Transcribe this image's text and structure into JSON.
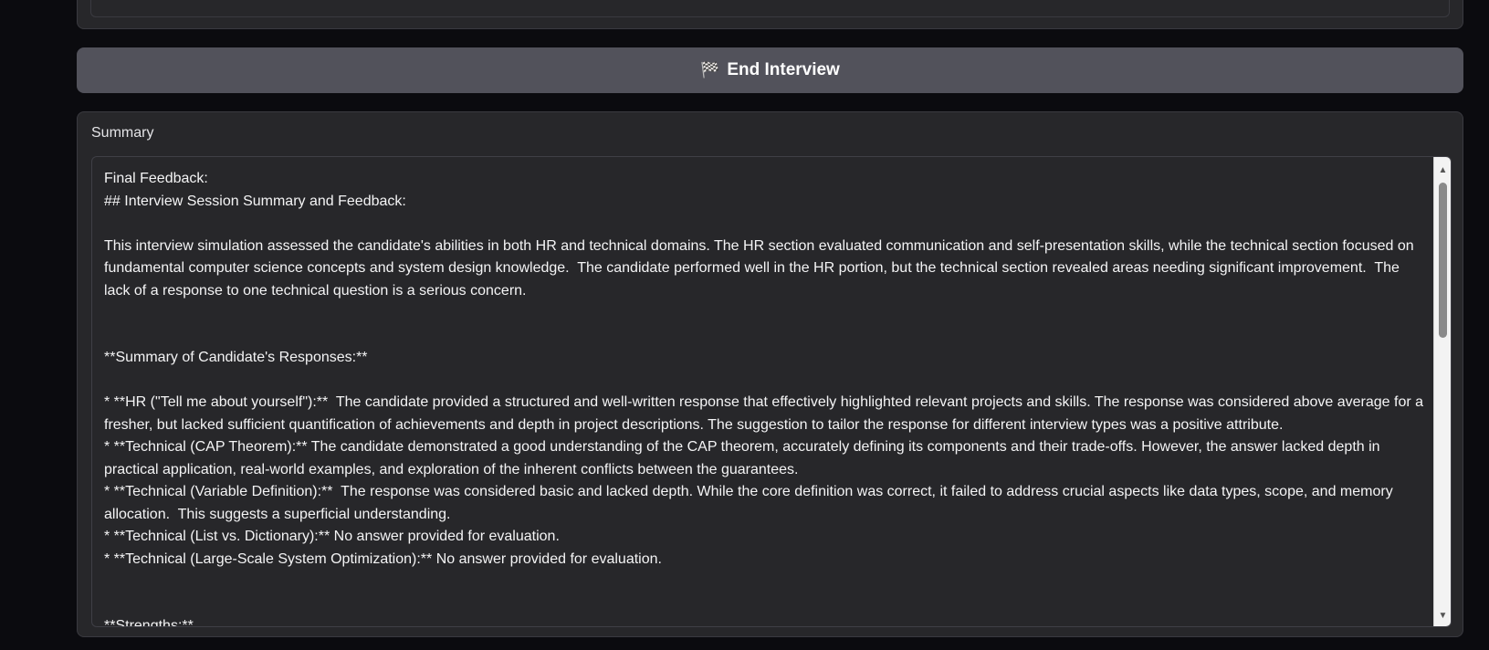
{
  "end_button": {
    "icon": "checkered-flag-icon",
    "glyph": "🏁",
    "label": "End Interview"
  },
  "summary": {
    "label": "Summary",
    "lines": [
      "Final Feedback:",
      "## Interview Session Summary and Feedback:",
      "",
      "This interview simulation assessed the candidate's abilities in both HR and technical domains. The HR section evaluated communication and self-presentation skills, while the technical section focused on fundamental computer science concepts and system design knowledge.  The candidate performed well in the HR portion, but the technical section revealed areas needing significant improvement.  The lack of a response to one technical question is a serious concern.",
      "",
      "",
      "**Summary of Candidate's Responses:**",
      "",
      "* **HR (\"Tell me about yourself\"):**  The candidate provided a structured and well-written response that effectively highlighted relevant projects and skills. The response was considered above average for a fresher, but lacked sufficient quantification of achievements and depth in project descriptions. The suggestion to tailor the response for different interview types was a positive attribute.",
      "* **Technical (CAP Theorem):** The candidate demonstrated a good understanding of the CAP theorem, accurately defining its components and their trade-offs. However, the answer lacked depth in practical application, real-world examples, and exploration of the inherent conflicts between the guarantees.",
      "* **Technical (Variable Definition):**  The response was considered basic and lacked depth. While the core definition was correct, it failed to address crucial aspects like data types, scope, and memory allocation.  This suggests a superficial understanding.",
      "* **Technical (List vs. Dictionary):** No answer provided for evaluation.",
      "* **Technical (Large-Scale System Optimization):** No answer provided for evaluation.",
      "",
      "",
      "**Strengths:**"
    ]
  },
  "scrollbar": {
    "position_fraction": 0.0,
    "visible_fraction": 0.35
  }
}
